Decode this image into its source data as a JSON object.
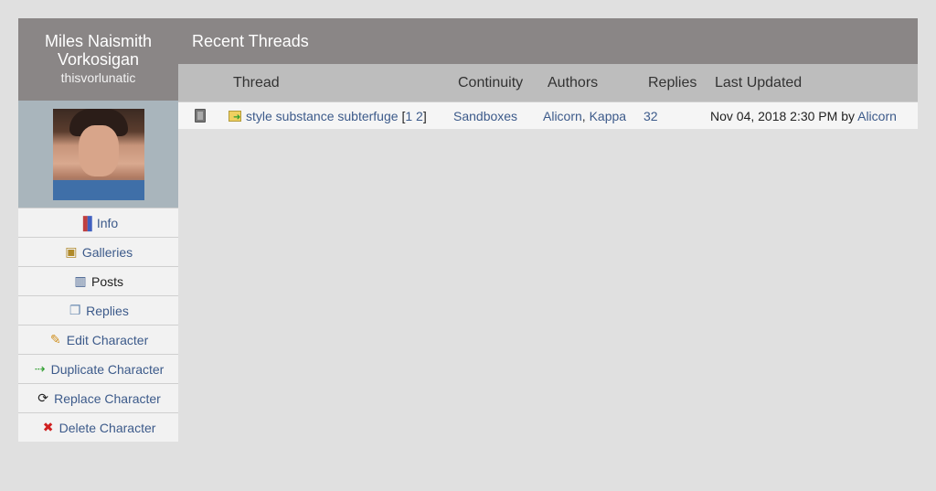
{
  "character": {
    "name": "Miles Naismith Vorkosigan",
    "screenname": "thisvorlunatic"
  },
  "menu": [
    {
      "label": "Info",
      "icon": "chart-icon"
    },
    {
      "label": "Galleries",
      "icon": "gallery-icon"
    },
    {
      "label": "Posts",
      "icon": "book-icon"
    },
    {
      "label": "Replies",
      "icon": "replies-icon"
    },
    {
      "label": "Edit Character",
      "icon": "pencil-icon"
    },
    {
      "label": "Duplicate Character",
      "icon": "duplicate-icon"
    },
    {
      "label": "Replace Character",
      "icon": "refresh-icon"
    },
    {
      "label": "Delete Character",
      "icon": "delete-icon"
    }
  ],
  "main": {
    "title": "Recent Threads",
    "columns": [
      "Thread",
      "Continuity",
      "Authors",
      "Replies",
      "Last Updated"
    ],
    "rows": [
      {
        "thread": "style substance subterfuge",
        "page_open": "[",
        "page1": "1",
        "page2": "2",
        "page_close": "]",
        "continuity": "Sandboxes",
        "author1": "Alicorn",
        "author_sep": ", ",
        "author2": "Kappa",
        "replies": "32",
        "updated": "Nov 04, 2018 2:30 PM by ",
        "updated_by": "Alicorn"
      }
    ]
  },
  "colors": {
    "header_bg": "#8a8686",
    "link": "#3c5a8a",
    "page_bg": "#e0e0e0"
  }
}
